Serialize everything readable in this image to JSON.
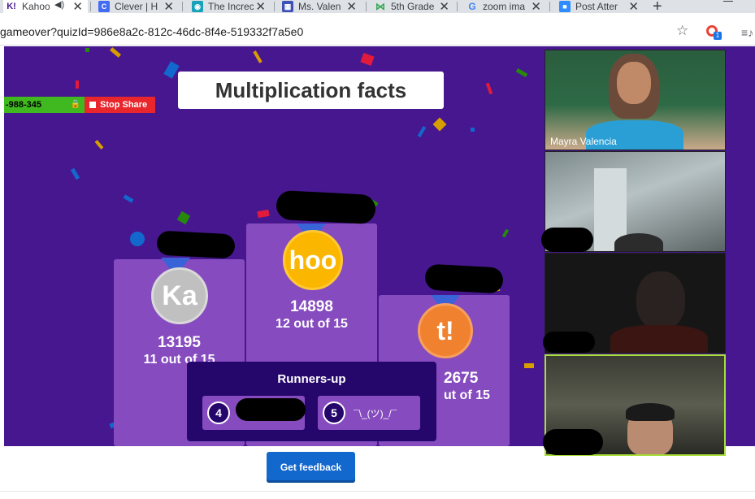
{
  "browser": {
    "tabs": [
      {
        "title": "Kahoo",
        "favicon_text": "K!",
        "favicon_color": "#46178f",
        "active": true
      },
      {
        "title": "Clever | H",
        "favicon_text": "C",
        "favicon_color": "#436cf2"
      },
      {
        "title": "The Increc",
        "favicon_text": "",
        "favicon_color": "#17a2b8"
      },
      {
        "title": "Ms. Valen",
        "favicon_text": "",
        "favicon_color": "#3f51b5"
      },
      {
        "title": "5th Grade",
        "favicon_text": "",
        "favicon_color": "#34a853"
      },
      {
        "title": "zoom ima",
        "favicon_text": "G",
        "favicon_color": "#4285f4"
      },
      {
        "title": "Post Atter",
        "favicon_text": "",
        "favicon_color": "#2d8cff"
      }
    ],
    "url": "gameover?quizId=986e8a2c-812c-46dc-8f4e-519332f7a5e0",
    "extension_badge": "1"
  },
  "share": {
    "meeting_id": "-988-345",
    "stop_label": "Stop Share"
  },
  "quiz": {
    "title": "Multiplication facts",
    "podium": [
      {
        "place": 2,
        "initials": "Ka",
        "medal_color": "#c0c0c0",
        "points": "13195",
        "correct": "11 out of 15"
      },
      {
        "place": 1,
        "initials": "hoo",
        "medal_color": "#fbb600",
        "points": "14898",
        "correct": "12 out of 15"
      },
      {
        "place": 3,
        "initials": "t!",
        "medal_color": "#f0812e",
        "points": "2675",
        "correct": "ut of 15"
      }
    ],
    "runners_up": {
      "title": "Runners-up",
      "items": [
        {
          "rank": "4",
          "name": ""
        },
        {
          "rank": "5",
          "name": "¯\\_(ツ)_/¯"
        }
      ]
    },
    "feedback_button": "Get feedback"
  },
  "zoom": {
    "participants": [
      {
        "name": "Mayra Valencia"
      },
      {
        "name": ""
      },
      {
        "name": ""
      },
      {
        "name": ""
      }
    ],
    "active_speaker_border": "#a8e03a"
  },
  "colors": {
    "kahoot_purple": "#46178f",
    "podium_purple": "#864cbf",
    "dark_panel": "#25076b",
    "button_blue": "#1368ce"
  }
}
